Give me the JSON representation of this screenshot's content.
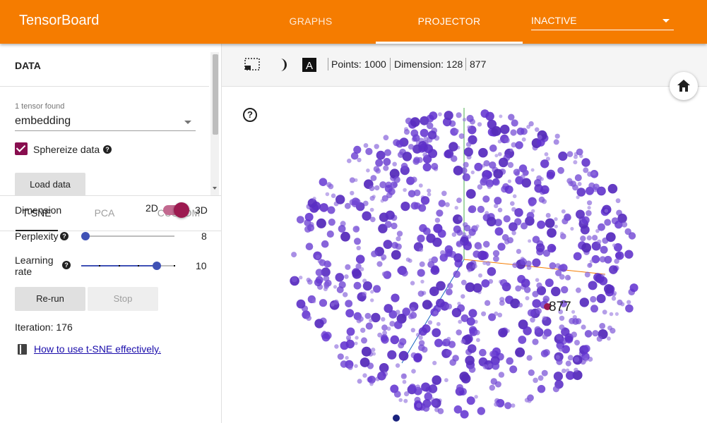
{
  "app": {
    "title": "TensorBoard"
  },
  "nav": {
    "tabs": [
      "GRAPHS",
      "PROJECTOR"
    ],
    "run_select": "INACTIVE"
  },
  "data_panel": {
    "title": "DATA",
    "tensor_found": "1 tensor found",
    "tensor_select": "embedding",
    "sphereize_label": "Sphereize data",
    "sphereize_checked": true,
    "load_button": "Load data"
  },
  "method_tabs": [
    "T-SNE",
    "PCA",
    "CUSTOM"
  ],
  "tsne": {
    "dimension_label": "Dimension",
    "dim_2d": "2D",
    "dim_3d": "3D",
    "dimension_value": "3D",
    "perplexity_label": "Perplexity",
    "perplexity_value": "8",
    "learning_rate_label_1": "Learning",
    "learning_rate_label_2": "rate",
    "learning_rate_value": "10",
    "rerun_button": "Re-run",
    "stop_button": "Stop",
    "iteration": "Iteration: 176",
    "help_link": "How to use t-SNE effectively."
  },
  "toolbar": {
    "points": "Points: 1000",
    "dimension": "Dimension: 128",
    "selected": "877"
  },
  "scatter": {
    "selected_label": "877",
    "point_color": "#6a3fd0",
    "selected_color": "#9c1a50"
  },
  "colors": {
    "brand": "#f57c00",
    "accent": "#880e4f",
    "slider": "#3f51b5"
  }
}
